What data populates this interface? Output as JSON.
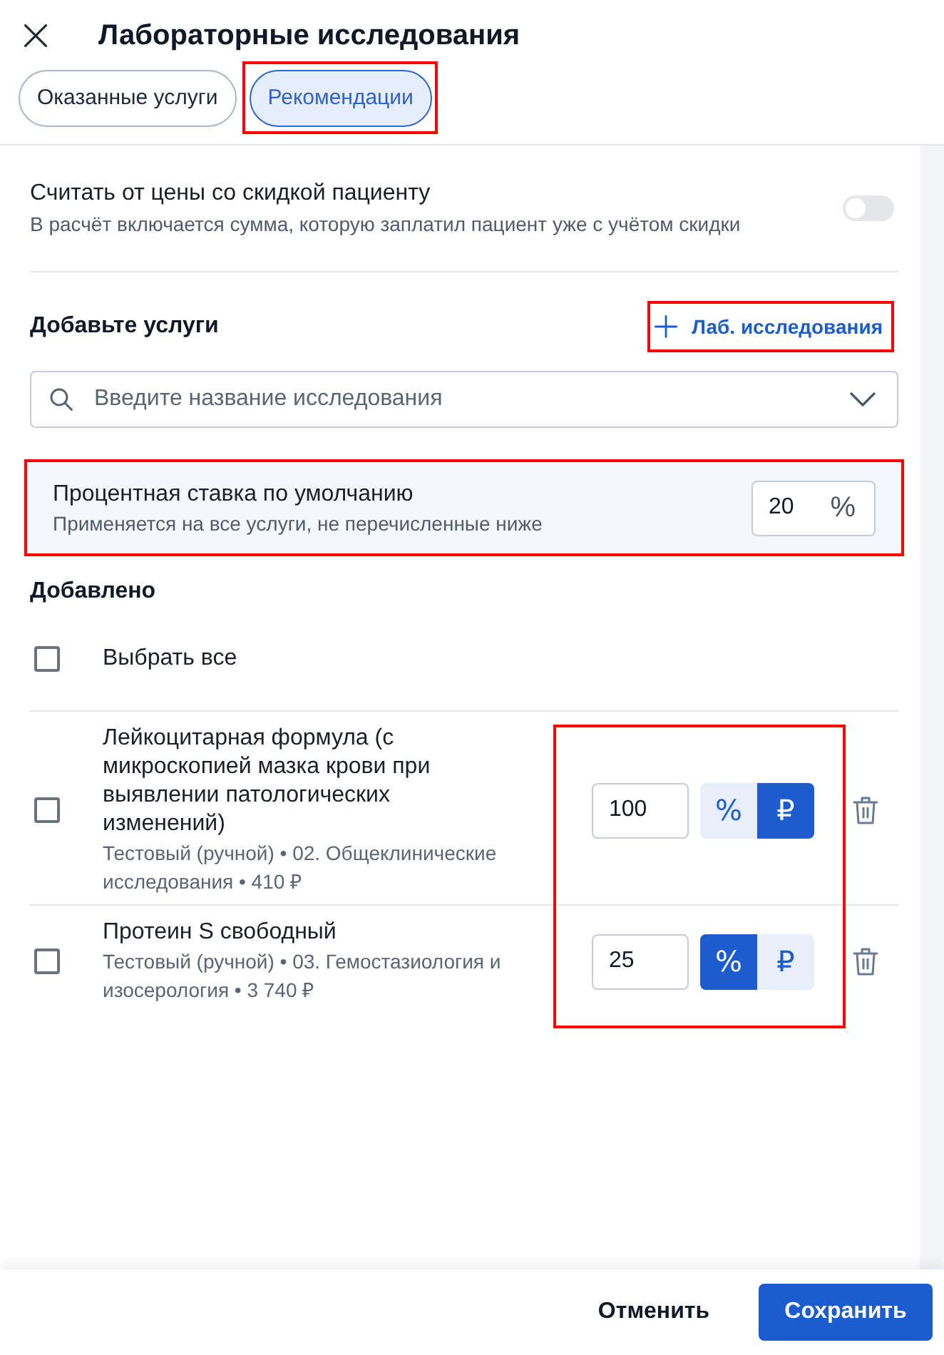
{
  "header": {
    "title": "Лабораторные исследования"
  },
  "tabs": [
    {
      "label": "Оказанные услуги",
      "selected": false,
      "annotated": false
    },
    {
      "label": "Рекомендации",
      "selected": true,
      "annotated": true
    }
  ],
  "discount_setting": {
    "title": "Считать от цены со скидкой пациенту",
    "description": "В расчёт включается сумма, которую заплатил пациент уже с учётом скидки",
    "on": false
  },
  "add_services": {
    "heading": "Добавьте услуги",
    "add_button": {
      "label": "Лаб. исследования",
      "annotated": true
    },
    "search": {
      "placeholder": "Введите название исследования"
    }
  },
  "default_rate": {
    "title": "Процентная ставка по умолчанию",
    "description": "Применяется на все услуги, не перечисленные ниже",
    "value": "20",
    "unit": "%",
    "annotated": true
  },
  "added": {
    "heading": "Добавлено",
    "select_all": {
      "label": "Выбрать все",
      "checked": false
    },
    "controls_annotated": true,
    "items": [
      {
        "name": "Лейкоцитарная формула (с микроскопией мазка крови при выявлении патологических изменений)",
        "details": "Тестовый (ручной) • 02. Общеклинические исследования • 410 ₽",
        "checked": false,
        "value": "100",
        "units": [
          {
            "label": "%",
            "selected": false
          },
          {
            "label": "₽",
            "selected": true
          }
        ]
      },
      {
        "name": "Протеин S свободный",
        "details": "Тестовый (ручной) • 03. Гемостазиология и изосерология • 3 740 ₽",
        "checked": false,
        "value": "25",
        "units": [
          {
            "label": "%",
            "selected": true
          },
          {
            "label": "₽",
            "selected": false
          }
        ]
      }
    ]
  },
  "footer": {
    "buttons": [
      {
        "label": "Отменить",
        "kind": "secondary"
      },
      {
        "label": "Сохранить",
        "kind": "primary"
      }
    ]
  }
}
